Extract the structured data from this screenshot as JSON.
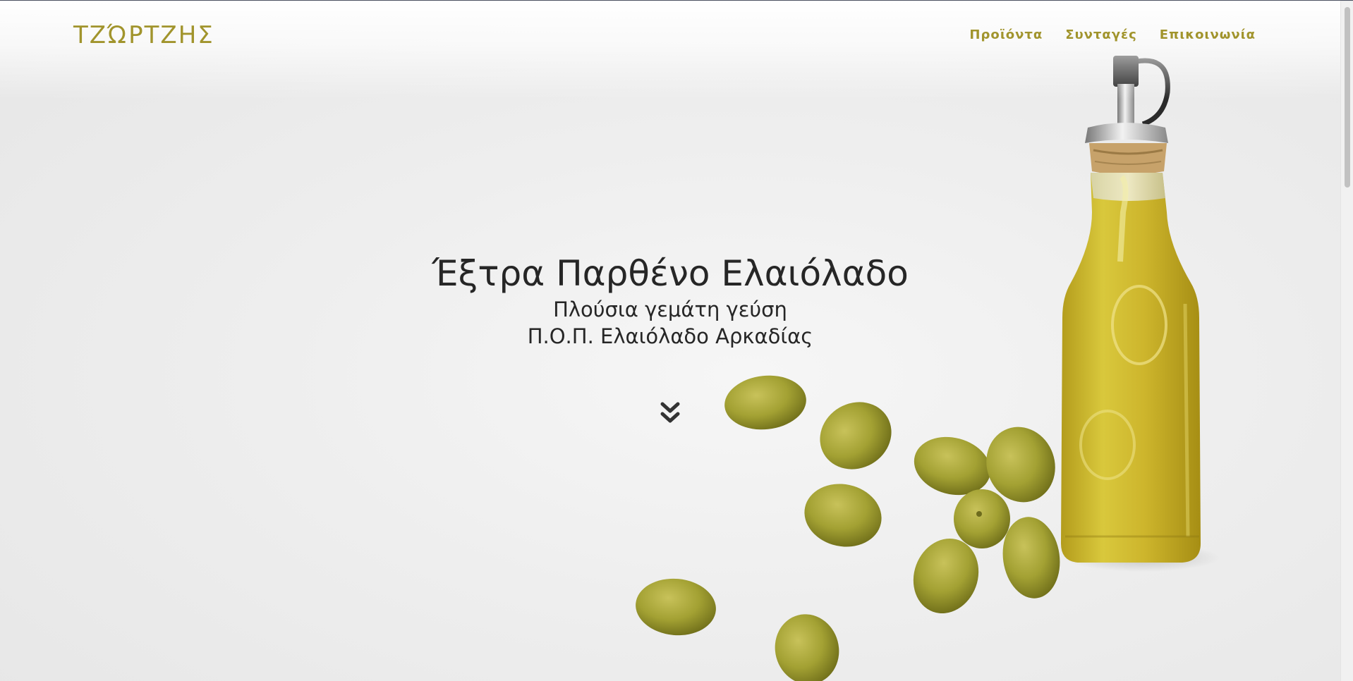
{
  "header": {
    "brand": "ΤΖΏΡΤΖΗΣ",
    "nav": [
      {
        "label": "Προϊόντα"
      },
      {
        "label": "Συνταγές"
      },
      {
        "label": "Επικοινωνία"
      }
    ]
  },
  "hero": {
    "title": "Έξτρα Παρθένο Ελαιόλαδο",
    "subtitle_1": "Πλούσια γεμάτη γεύση",
    "subtitle_2": "Π.Ο.Π. Ελαιόλαδο Αρκαδίας",
    "scroll_icon": "double-chevron-down-icon"
  },
  "colors": {
    "accent": "#a1942c",
    "text": "#262626",
    "olive": "#9a9b2e",
    "oil": "#c9b22a"
  }
}
